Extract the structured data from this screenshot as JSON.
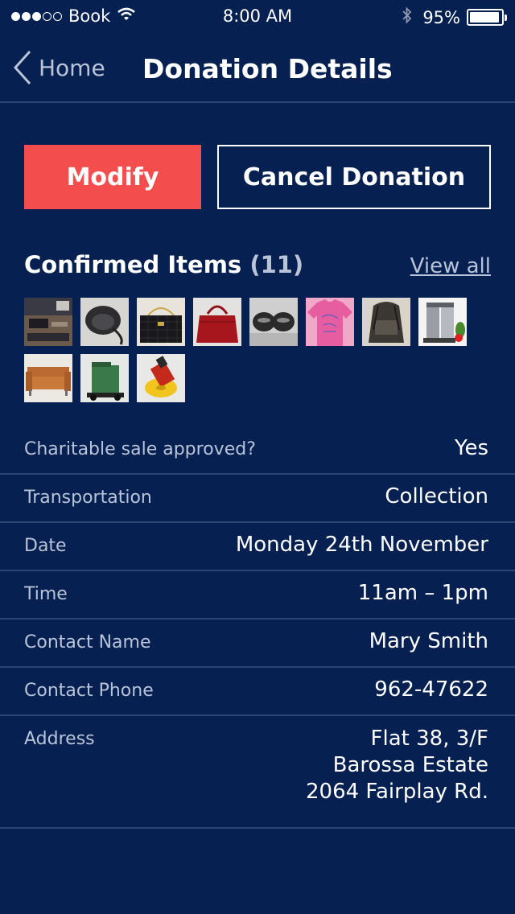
{
  "status_bar": {
    "carrier": "Book",
    "time": "8:00 AM",
    "battery_pct": "95%",
    "battery_level": 0.95,
    "signal_bars_filled": 3,
    "signal_bars_total": 5,
    "icons": [
      "wifi-icon",
      "bluetooth-icon",
      "battery-icon"
    ]
  },
  "nav": {
    "back_label": "Home",
    "title": "Donation Details"
  },
  "actions": {
    "modify_label": "Modify",
    "cancel_label": "Cancel Donation"
  },
  "items": {
    "title": "Confirmed Items",
    "count": "(11)",
    "view_all": "View all",
    "thumbnails": [
      "electronics-desk-thumbnail",
      "helmet-thumbnail",
      "quilted-handbag-thumbnail",
      "red-handbag-thumbnail",
      "roller-skates-thumbnail",
      "pink-tshirt-thumbnail",
      "backpack-thumbnail",
      "drink-mixer-thumbnail",
      "sofa-thumbnail",
      "floor-scrubber-thumbnail",
      "polisher-tool-thumbnail"
    ]
  },
  "details": {
    "rows": [
      {
        "label": "Charitable sale approved?",
        "value": "Yes"
      },
      {
        "label": "Transportation",
        "value": "Collection"
      },
      {
        "label": "Date",
        "value": "Monday 24th November"
      },
      {
        "label": "Time",
        "value": "11am – 1pm"
      },
      {
        "label": "Contact Name",
        "value": "Mary Smith"
      },
      {
        "label": "Contact Phone",
        "value": "962-47622"
      }
    ],
    "address": {
      "label": "Address",
      "lines": [
        "Flat 38, 3/F",
        "Barossa Estate",
        "2064 Fairplay Rd."
      ]
    }
  },
  "colors": {
    "background": "#052051",
    "accent": "#f34d4e",
    "muted_text": "#b9c4d8",
    "divider": "#2b4672"
  }
}
